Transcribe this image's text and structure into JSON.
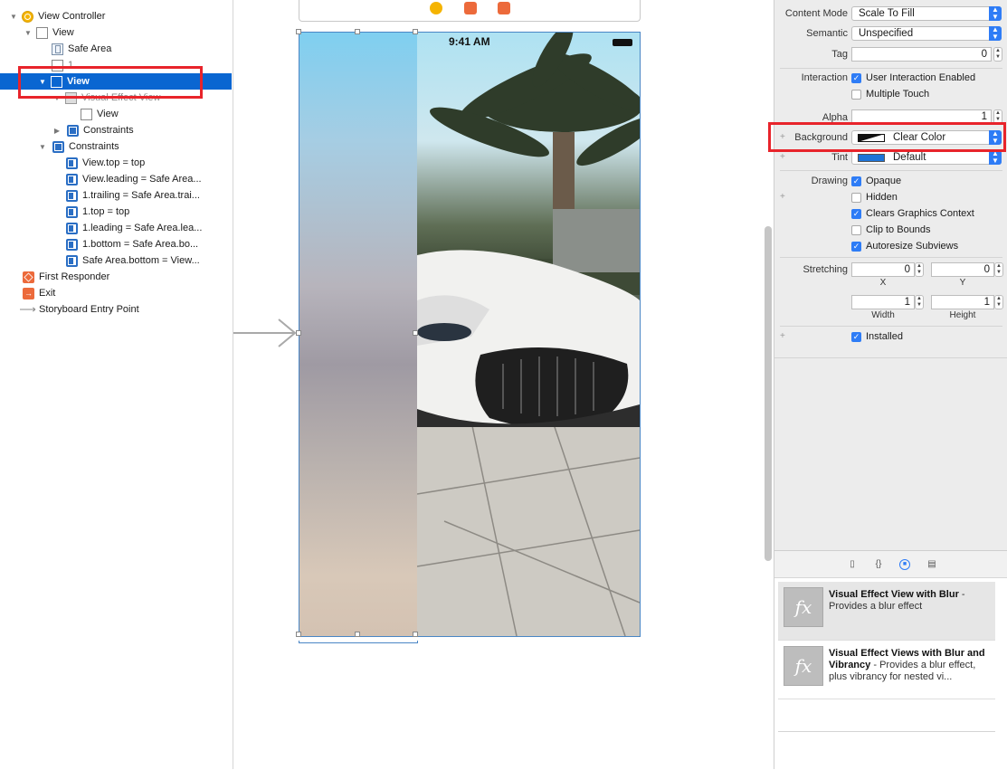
{
  "outline": {
    "rows": [
      {
        "label": "View Controller"
      },
      {
        "label": "View"
      },
      {
        "label": "Safe Area"
      },
      {
        "label": "1"
      },
      {
        "label": "View"
      },
      {
        "label": "Visual Effect View"
      },
      {
        "label": "View"
      },
      {
        "label": "Constraints"
      },
      {
        "label": "Constraints"
      },
      {
        "label": "View.top = top"
      },
      {
        "label": "View.leading = Safe Area..."
      },
      {
        "label": "1.trailing = Safe Area.trai..."
      },
      {
        "label": "1.top = top"
      },
      {
        "label": "1.leading = Safe Area.lea..."
      },
      {
        "label": "1.bottom = Safe Area.bo..."
      },
      {
        "label": "Safe Area.bottom = View..."
      },
      {
        "label": "First Responder"
      },
      {
        "label": "Exit"
      },
      {
        "label": "Storyboard Entry Point"
      }
    ]
  },
  "canvas": {
    "status_time": "9:41 AM"
  },
  "inspector": {
    "content_mode_label": "Content Mode",
    "content_mode_value": "Scale To Fill",
    "semantic_label": "Semantic",
    "semantic_value": "Unspecified",
    "tag_label": "Tag",
    "tag_value": "0",
    "interaction_label": "Interaction",
    "user_interaction": "User Interaction Enabled",
    "multiple_touch": "Multiple Touch",
    "alpha_label": "Alpha",
    "alpha_value": "1",
    "background_label": "Background",
    "background_value": "Clear Color",
    "tint_label": "Tint",
    "tint_value": "Default",
    "drawing_label": "Drawing",
    "opaque": "Opaque",
    "hidden": "Hidden",
    "clears_graphics": "Clears Graphics Context",
    "clip_to_bounds": "Clip to Bounds",
    "autoresize": "Autoresize Subviews",
    "stretching_label": "Stretching",
    "stretch_x": "0",
    "stretch_y": "0",
    "x_label": "X",
    "y_label": "Y",
    "stretch_w": "1",
    "stretch_h": "1",
    "width_label": "Width",
    "height_label": "Height",
    "installed": "Installed",
    "tint_color": "#1e74d8"
  },
  "library": {
    "items": [
      {
        "title": "Visual Effect View with Blur",
        "desc": "Provides a blur effect"
      },
      {
        "title": "Visual Effect Views with Blur and Vibrancy",
        "desc": "Provides a blur effect, plus vibrancy for nested vi..."
      }
    ]
  }
}
